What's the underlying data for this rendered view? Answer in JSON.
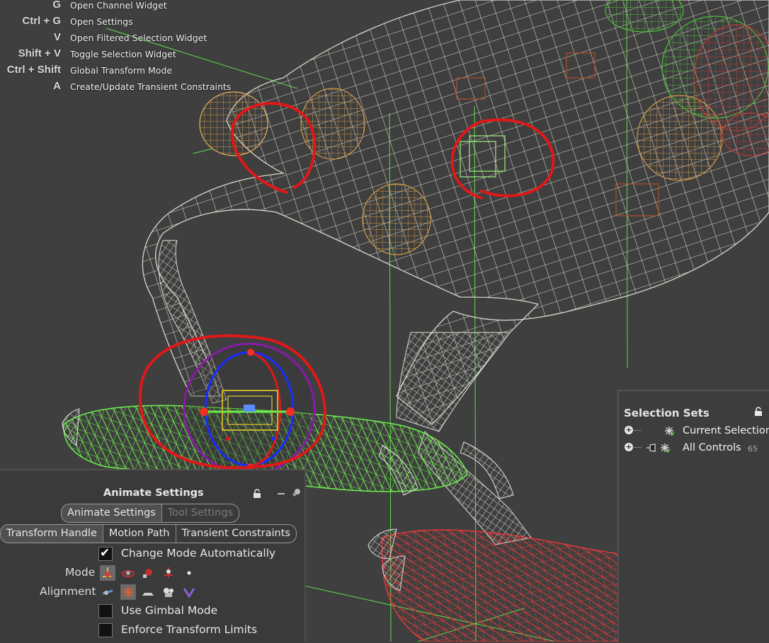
{
  "hotkeys": [
    {
      "key": "G",
      "label": "Open Channel Widget"
    },
    {
      "key": "Ctrl + G",
      "label": "Open Settings"
    },
    {
      "key": "V",
      "label": "Open Filtered Selection Widget"
    },
    {
      "key": "Shift + V",
      "label": "Toggle Selection Widget"
    },
    {
      "key": "Ctrl + Shift",
      "label": "Global Transform Mode"
    },
    {
      "key": "A",
      "label": "Create/Update Transient Constraints"
    }
  ],
  "selection_sets": {
    "title": "Selection Sets",
    "items": [
      {
        "label": "Current Selection",
        "count": ""
      },
      {
        "label": "All Controls",
        "count": "65"
      }
    ]
  },
  "animate_settings": {
    "title": "Animate Settings",
    "top_tabs": [
      "Animate Settings",
      "Tool Settings"
    ],
    "sub_tabs": [
      "Transform Handle",
      "Motion Path",
      "Transient Constraints"
    ],
    "change_mode_label": "Change Mode Automatically",
    "mode_label": "Mode",
    "alignment_label": "Alignment",
    "gimbal_label": "Use Gimbal Mode",
    "limits_label": "Enforce Transform Limits"
  },
  "colors": {
    "background": "#3f3f3f",
    "wire_white": "#dcdcd2",
    "wire_green": "#6cf24a",
    "wire_red": "#e23a3a",
    "wire_orange": "#d29a48",
    "annotation_red": "#e01818",
    "axis_blue": "#1a2cff",
    "axis_purple": "#8a1aa8"
  },
  "icons": {
    "lock": "lock-icon",
    "add": "add-circle-icon",
    "selection": "asterisk-select-icon",
    "mode": [
      "translate-mode-icon",
      "rotate-mode-icon",
      "scale-mode-icon",
      "joint-mode-icon",
      "point-mode-icon"
    ],
    "alignment": [
      "world-align-icon",
      "local-align-icon",
      "plane-align-icon",
      "camera-align-icon",
      "custom-align-icon"
    ]
  }
}
